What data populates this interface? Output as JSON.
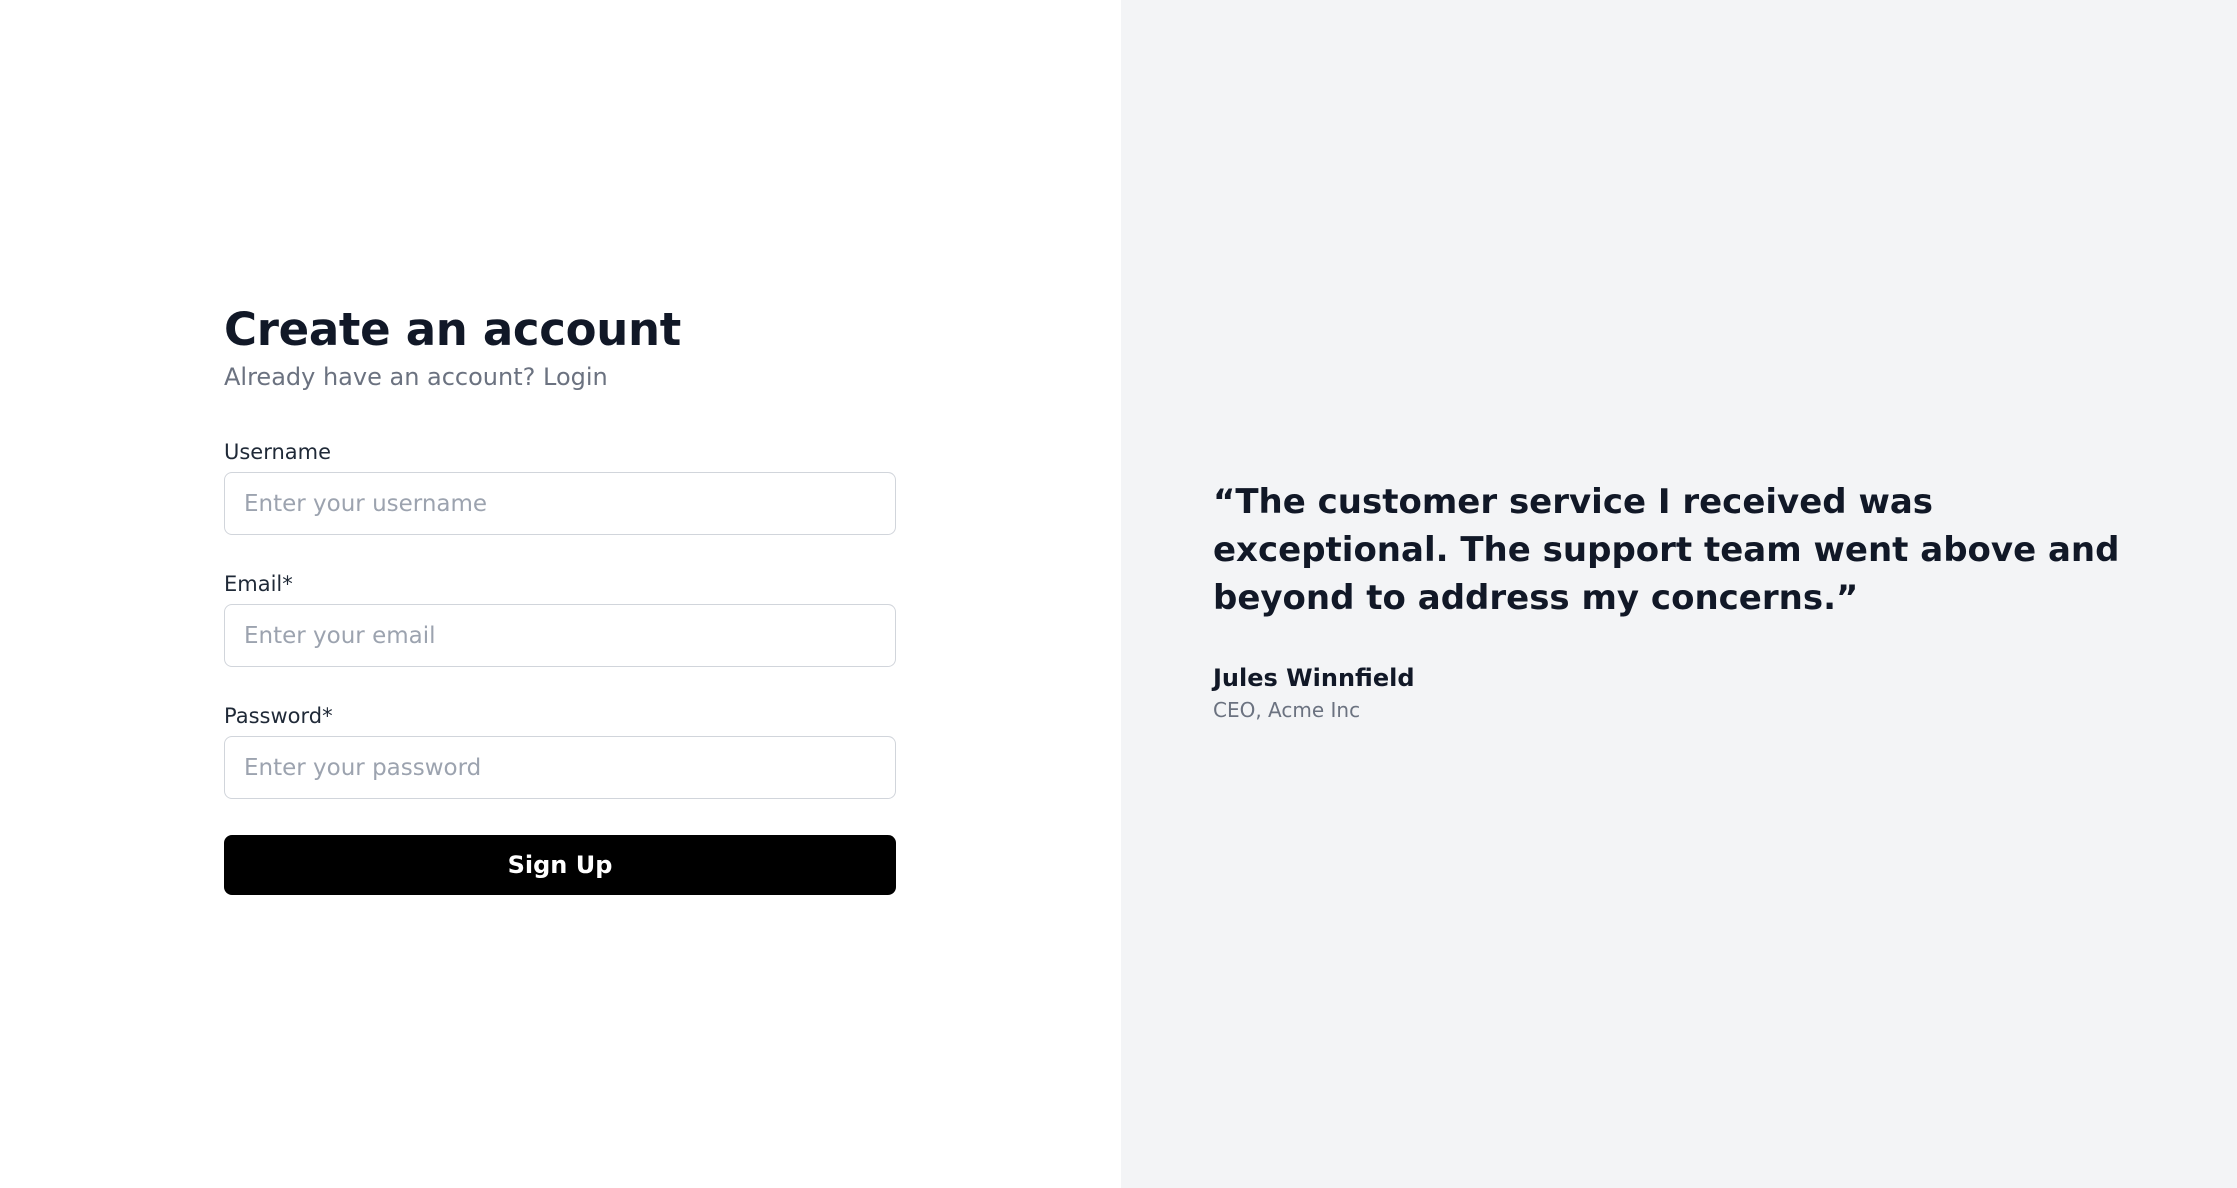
{
  "signup": {
    "title": "Create an account",
    "subtitle_prefix": "Already have an account? ",
    "login_link": "Login",
    "username": {
      "label": "Username",
      "placeholder": "Enter your username",
      "value": ""
    },
    "email": {
      "label": "Email*",
      "placeholder": "Enter your email",
      "value": ""
    },
    "password": {
      "label": "Password*",
      "placeholder": "Enter your password",
      "value": ""
    },
    "submit_label": "Sign Up"
  },
  "testimonial": {
    "quote": "“The customer service I received was exceptional. The support team went above and beyond to address my concerns.”",
    "author_name": "Jules Winnfield",
    "author_role": "CEO, Acme Inc"
  },
  "colors": {
    "primary_button": "#000000",
    "panel_background": "#f3f4f6",
    "muted_text": "#6b7280"
  }
}
